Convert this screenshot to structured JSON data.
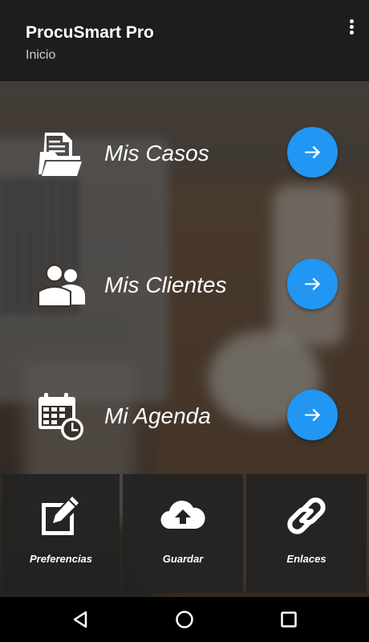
{
  "appbar": {
    "title": "ProcuSmart Pro",
    "subtitle": "Inicio",
    "menu_icon": "more-vert-icon"
  },
  "menu": [
    {
      "label": "Mis Casos",
      "icon": "folder-documents-icon",
      "action_icon": "arrow-right-icon"
    },
    {
      "label": "Mis Clientes",
      "icon": "users-icon",
      "action_icon": "arrow-right-icon"
    },
    {
      "label": "Mi Agenda",
      "icon": "calendar-clock-icon",
      "action_icon": "arrow-right-icon"
    }
  ],
  "tiles": [
    {
      "label": "Preferencias",
      "icon": "edit-icon"
    },
    {
      "label": "Guardar",
      "icon": "cloud-upload-icon"
    },
    {
      "label": "Enlaces",
      "icon": "link-icon"
    }
  ],
  "navbar": [
    "back-icon",
    "home-icon",
    "recents-icon"
  ],
  "colors": {
    "accent": "#2196f3",
    "appbar": "#1d1d1d"
  }
}
